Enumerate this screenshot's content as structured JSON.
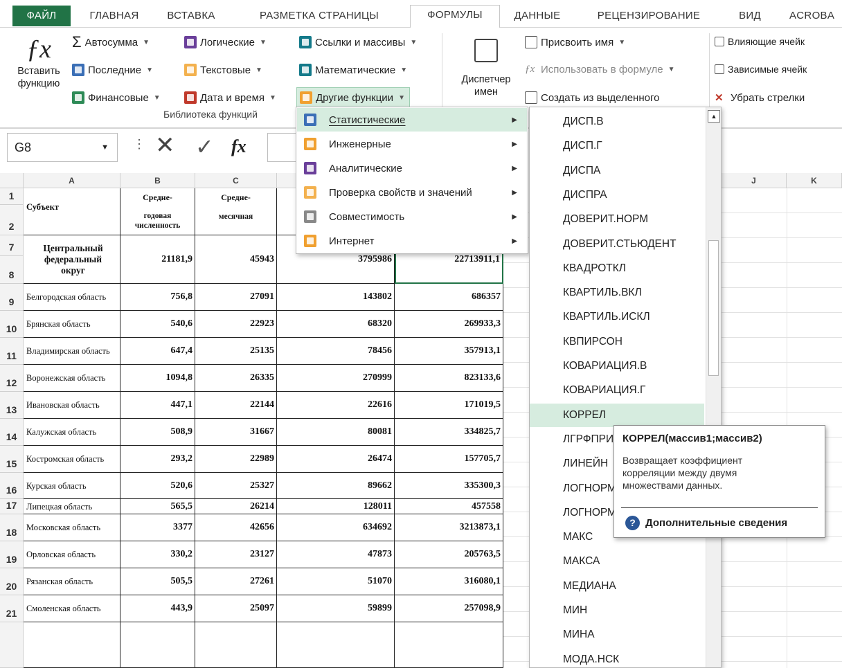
{
  "tabs": [
    "ФАЙЛ",
    "ГЛАВНАЯ",
    "ВСТАВКА",
    "РАЗМЕТКА СТРАНИЦЫ",
    "ФОРМУЛЫ",
    "ДАННЫЕ",
    "РЕЦЕНЗИРОВАНИЕ",
    "ВИД",
    "ACROBA"
  ],
  "ribbon": {
    "insert_fn_line1": "Вставить",
    "insert_fn_line2": "функцию",
    "autosum": "Автосумма",
    "recent": "Последние",
    "financial": "Финансовые",
    "logical": "Логические",
    "text": "Текстовые",
    "datetime": "Дата и время",
    "lookup": "Ссылки и массивы",
    "math": "Математические",
    "other": "Другие функции",
    "library_group": "Библиотека функций",
    "name_manager_line1": "Диспетчер",
    "name_manager_line2": "имен",
    "define_name": "Присвоить имя",
    "use_in_formula": "Использовать в формуле",
    "create_from_selection": "Создать из выделенного",
    "trace_precedents": "Влияющие ячейк",
    "trace_dependents": "Зависимые ячейк",
    "remove_arrows": "Убрать стрелки"
  },
  "formula_bar": {
    "name_box": "G8",
    "fx": "fx"
  },
  "columns": [
    "A",
    "B",
    "C",
    "J",
    "K"
  ],
  "header_rows": {
    "subject": "Субъект",
    "b_line1": "Средне-",
    "b_line2": "годовая численность",
    "c_line1": "Средне-",
    "c_line2": "месячная"
  },
  "rows": [
    {
      "num": "7",
      "name": "Центральный",
      "bold": true
    },
    {
      "num": "8",
      "name": "федеральный округ",
      "b": "21181,9",
      "c": "45943",
      "d": "3795986",
      "e": "22713911,1"
    },
    {
      "num": "9",
      "name": "Белгородская область",
      "b": "756,8",
      "c": "27091",
      "d": "143802",
      "e": "686357"
    },
    {
      "num": "10",
      "name": "Брянская область",
      "b": "540,6",
      "c": "22923",
      "d": "68320",
      "e": "269933,3"
    },
    {
      "num": "11",
      "name": "Владимирская область",
      "b": "647,4",
      "c": "25135",
      "d": "78456",
      "e": "357913,1"
    },
    {
      "num": "12",
      "name": "Воронежская область",
      "b": "1094,8",
      "c": "26335",
      "d": "270999",
      "e": "823133,6"
    },
    {
      "num": "13",
      "name": "Ивановская область",
      "b": "447,1",
      "c": "22144",
      "d": "22616",
      "e": "171019,5"
    },
    {
      "num": "14",
      "name": "Калужская область",
      "b": "508,9",
      "c": "31667",
      "d": "80081",
      "e": "334825,7"
    },
    {
      "num": "15",
      "name": "Костромская область",
      "b": "293,2",
      "c": "22989",
      "d": "26474",
      "e": "157705,7"
    },
    {
      "num": "16",
      "name": "Курская область",
      "b": "520,6",
      "c": "25327",
      "d": "89662",
      "e": "335300,3"
    },
    {
      "num": "17",
      "name": "Липецкая область",
      "b": "565,5",
      "c": "26214",
      "d": "128011",
      "e": "457558"
    },
    {
      "num": "18",
      "name": "Московская область",
      "b": "3377",
      "c": "42656",
      "d": "634692",
      "e": "3213873,1"
    },
    {
      "num": "19",
      "name": "Орловская область",
      "b": "330,2",
      "c": "23127",
      "d": "47873",
      "e": "205763,5"
    },
    {
      "num": "20",
      "name": "Рязанская область",
      "b": "505,5",
      "c": "27261",
      "d": "51070",
      "e": "316080,1"
    },
    {
      "num": "21",
      "name": "Смоленская область",
      "b": "443,9",
      "c": "25097",
      "d": "59899",
      "e": "257098,9"
    }
  ],
  "menu": [
    {
      "label": "Статистические",
      "icon": "chart-icon"
    },
    {
      "label": "Инженерные",
      "icon": "engineering-icon"
    },
    {
      "label": "Аналитические",
      "icon": "cube-icon"
    },
    {
      "label": "Проверка свойств и значений",
      "icon": "info-icon"
    },
    {
      "label": "Совместимость",
      "icon": "warning-icon"
    },
    {
      "label": "Интернет",
      "icon": "web-icon"
    }
  ],
  "functions": [
    "ДИСП.В",
    "ДИСП.Г",
    "ДИСПА",
    "ДИСПРА",
    "ДОВЕРИТ.НОРМ",
    "ДОВЕРИТ.СТЬЮДЕНТ",
    "КВАДРОТКЛ",
    "КВАРТИЛЬ.ВКЛ",
    "КВАРТИЛЬ.ИСКЛ",
    "КВПИРСОН",
    "КОВАРИАЦИЯ.В",
    "КОВАРИАЦИЯ.Г",
    "КОРРЕЛ",
    "ЛГРФПРИ",
    "ЛИНЕЙН",
    "ЛОГНОРМ",
    "ЛОГНОРМ",
    "МАКС",
    "МАКСА",
    "МЕДИАНА",
    "МИН",
    "МИНА",
    "МОДА.НСК"
  ],
  "tooltip": {
    "signature": "КОРРЕЛ(массив1;массив2)",
    "description": "Возвращает коэффициент корреляции между двумя множествами данных.",
    "more": "Дополнительные сведения"
  },
  "colors": {
    "accent": "#217346",
    "highlight": "#d6ecdf"
  }
}
